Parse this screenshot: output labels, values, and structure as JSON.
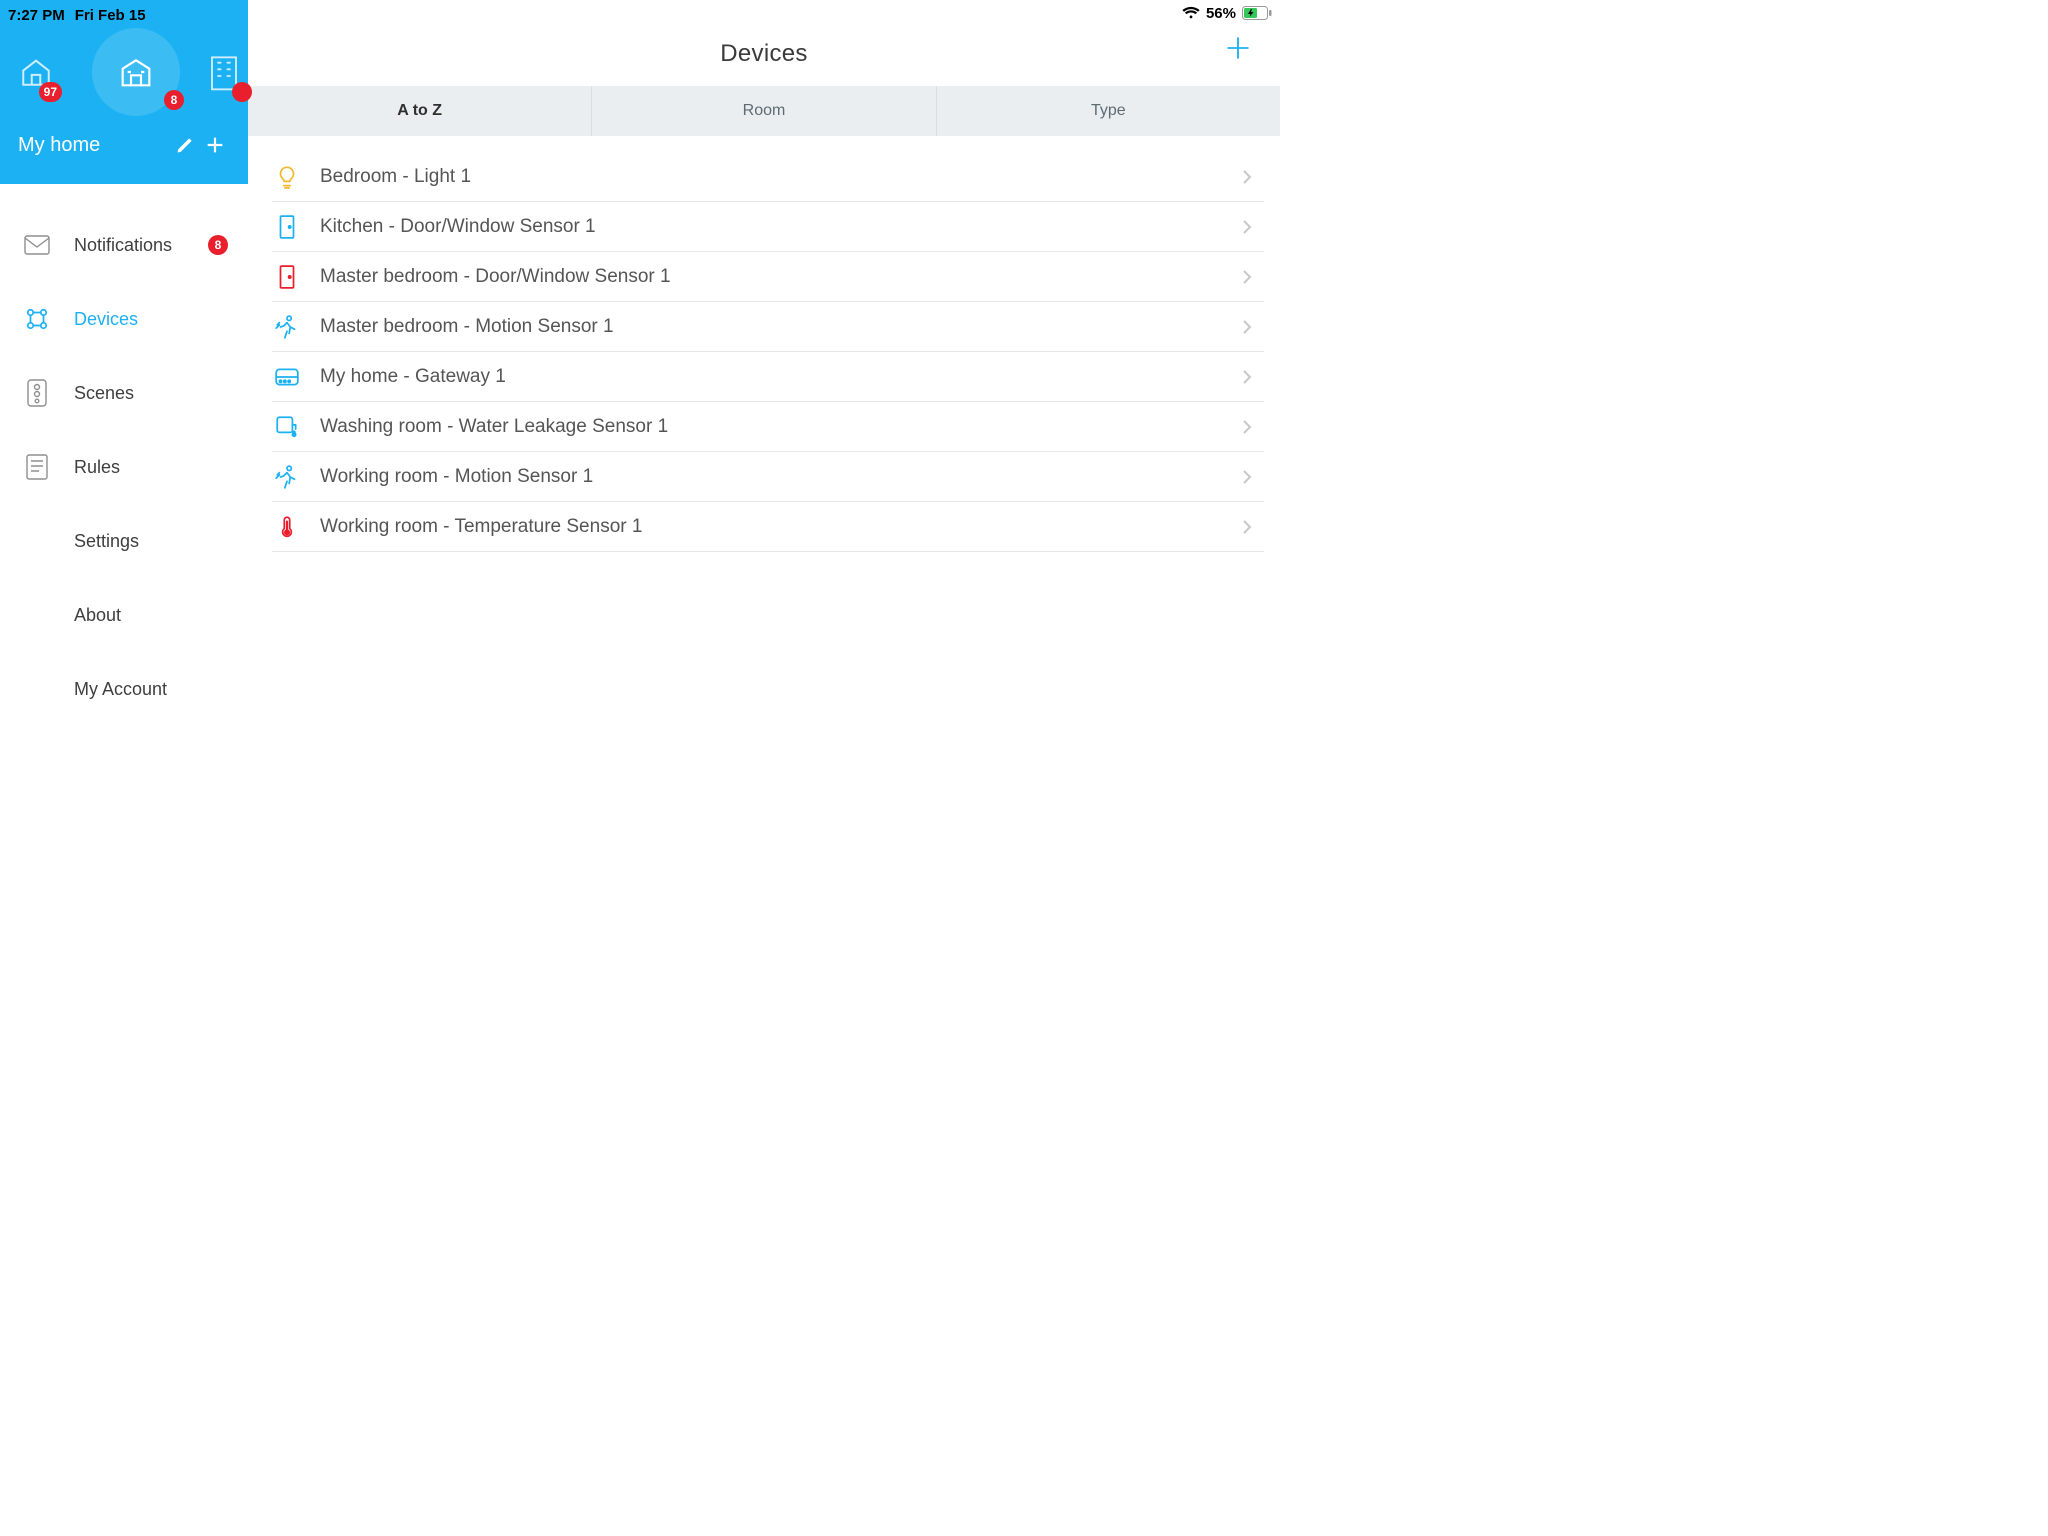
{
  "status": {
    "time": "7:27 PM",
    "date": "Fri Feb 15",
    "battery": "56%"
  },
  "home": {
    "name": "My home",
    "tabs": {
      "left_badge": "97",
      "center_badge": "8",
      "right_badge": ""
    }
  },
  "nav": {
    "notifications": {
      "label": "Notifications",
      "badge": "8"
    },
    "devices": {
      "label": "Devices"
    },
    "scenes": {
      "label": "Scenes"
    },
    "rules": {
      "label": "Rules"
    },
    "settings": {
      "label": "Settings"
    },
    "about": {
      "label": "About"
    },
    "account": {
      "label": "My Account"
    }
  },
  "main": {
    "title": "Devices",
    "segments": {
      "a_to_z": "A to Z",
      "room": "Room",
      "type": "Type"
    },
    "devices": [
      {
        "label": "Bedroom - Light 1",
        "icon": "light",
        "color": "#f2b92c"
      },
      {
        "label": "Kitchen - Door/Window Sensor 1",
        "icon": "door",
        "color": "#1cb1f2"
      },
      {
        "label": "Master bedroom - Door/Window Sensor 1",
        "icon": "door",
        "color": "#ea1f2d"
      },
      {
        "label": "Master bedroom - Motion Sensor 1",
        "icon": "motion",
        "color": "#1cb1f2"
      },
      {
        "label": "My home - Gateway 1",
        "icon": "gateway",
        "color": "#1cb1f2"
      },
      {
        "label": "Washing room - Water Leakage Sensor 1",
        "icon": "water",
        "color": "#1cb1f2"
      },
      {
        "label": "Working room - Motion Sensor 1",
        "icon": "motion",
        "color": "#1cb1f2"
      },
      {
        "label": "Working room - Temperature Sensor 1",
        "icon": "temp",
        "color": "#ea1f2d"
      }
    ]
  }
}
